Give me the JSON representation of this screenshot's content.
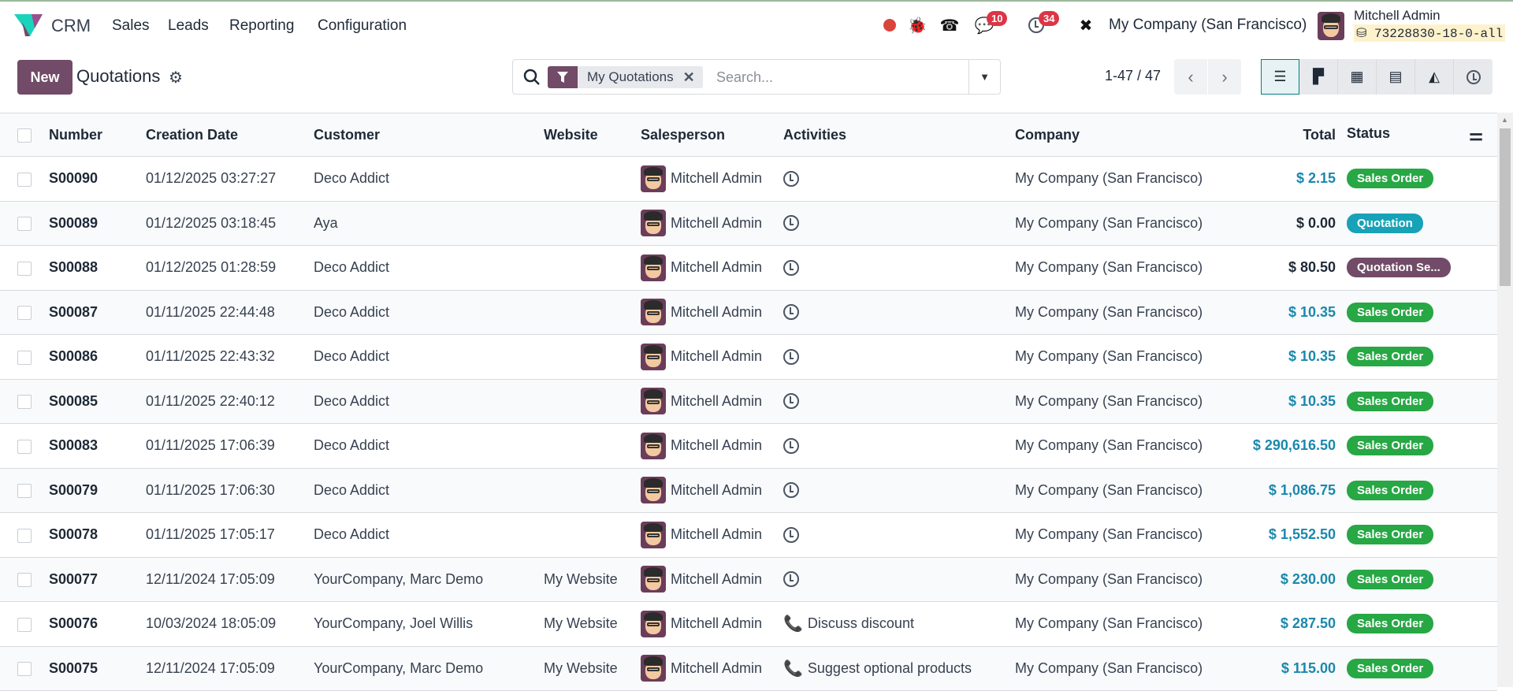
{
  "nav": {
    "app": "CRM",
    "menus": [
      "Sales",
      "Leads",
      "Reporting",
      "Configuration"
    ],
    "messages_count": "10",
    "activities_count": "34",
    "company": "My Company (San Francisco)",
    "user": "Mitchell Admin",
    "database": "73228830-18-0-all"
  },
  "control": {
    "new_label": "New",
    "title": "Quotations",
    "facet": "My Quotations",
    "search_placeholder": "Search...",
    "pager": "1-47 / 47"
  },
  "columns": {
    "number": "Number",
    "date": "Creation Date",
    "customer": "Customer",
    "website": "Website",
    "salesperson": "Salesperson",
    "activities": "Activities",
    "company": "Company",
    "total": "Total",
    "status": "Status"
  },
  "status_colors": {
    "Sales Order": "#28a745",
    "Quotation": "#17a2b8",
    "Quotation Se...": "#714b67"
  },
  "rows": [
    {
      "number": "S00090",
      "date": "01/12/2025 03:27:27",
      "customer": "Deco Addict",
      "website": "",
      "salesperson": "Mitchell Admin",
      "activity": "",
      "company": "My Company (San Francisco)",
      "total": "$ 2.15",
      "status": "Sales Order"
    },
    {
      "number": "S00089",
      "date": "01/12/2025 03:18:45",
      "customer": "Aya",
      "website": "",
      "salesperson": "Mitchell Admin",
      "activity": "",
      "company": "My Company (San Francisco)",
      "total": "$ 0.00",
      "status": "Quotation"
    },
    {
      "number": "S00088",
      "date": "01/12/2025 01:28:59",
      "customer": "Deco Addict",
      "website": "",
      "salesperson": "Mitchell Admin",
      "activity": "",
      "company": "My Company (San Francisco)",
      "total": "$ 80.50",
      "status": "Quotation Se..."
    },
    {
      "number": "S00087",
      "date": "01/11/2025 22:44:48",
      "customer": "Deco Addict",
      "website": "",
      "salesperson": "Mitchell Admin",
      "activity": "",
      "company": "My Company (San Francisco)",
      "total": "$ 10.35",
      "status": "Sales Order"
    },
    {
      "number": "S00086",
      "date": "01/11/2025 22:43:32",
      "customer": "Deco Addict",
      "website": "",
      "salesperson": "Mitchell Admin",
      "activity": "",
      "company": "My Company (San Francisco)",
      "total": "$ 10.35",
      "status": "Sales Order"
    },
    {
      "number": "S00085",
      "date": "01/11/2025 22:40:12",
      "customer": "Deco Addict",
      "website": "",
      "salesperson": "Mitchell Admin",
      "activity": "",
      "company": "My Company (San Francisco)",
      "total": "$ 10.35",
      "status": "Sales Order"
    },
    {
      "number": "S00083",
      "date": "01/11/2025 17:06:39",
      "customer": "Deco Addict",
      "website": "",
      "salesperson": "Mitchell Admin",
      "activity": "",
      "company": "My Company (San Francisco)",
      "total": "$ 290,616.50",
      "status": "Sales Order"
    },
    {
      "number": "S00079",
      "date": "01/11/2025 17:06:30",
      "customer": "Deco Addict",
      "website": "",
      "salesperson": "Mitchell Admin",
      "activity": "",
      "company": "My Company (San Francisco)",
      "total": "$ 1,086.75",
      "status": "Sales Order"
    },
    {
      "number": "S00078",
      "date": "01/11/2025 17:05:17",
      "customer": "Deco Addict",
      "website": "",
      "salesperson": "Mitchell Admin",
      "activity": "",
      "company": "My Company (San Francisco)",
      "total": "$ 1,552.50",
      "status": "Sales Order"
    },
    {
      "number": "S00077",
      "date": "12/11/2024 17:05:09",
      "customer": "YourCompany, Marc Demo",
      "website": "My Website",
      "salesperson": "Mitchell Admin",
      "activity": "",
      "company": "My Company (San Francisco)",
      "total": "$ 230.00",
      "status": "Sales Order"
    },
    {
      "number": "S00076",
      "date": "10/03/2024 18:05:09",
      "customer": "YourCompany, Joel Willis",
      "website": "My Website",
      "salesperson": "Mitchell Admin",
      "activity": "Discuss discount",
      "company": "My Company (San Francisco)",
      "total": "$ 287.50",
      "status": "Sales Order"
    },
    {
      "number": "S00075",
      "date": "12/11/2024 17:05:09",
      "customer": "YourCompany, Marc Demo",
      "website": "My Website",
      "salesperson": "Mitchell Admin",
      "activity": "Suggest optional products",
      "company": "My Company (San Francisco)",
      "total": "$ 115.00",
      "status": "Sales Order"
    }
  ]
}
